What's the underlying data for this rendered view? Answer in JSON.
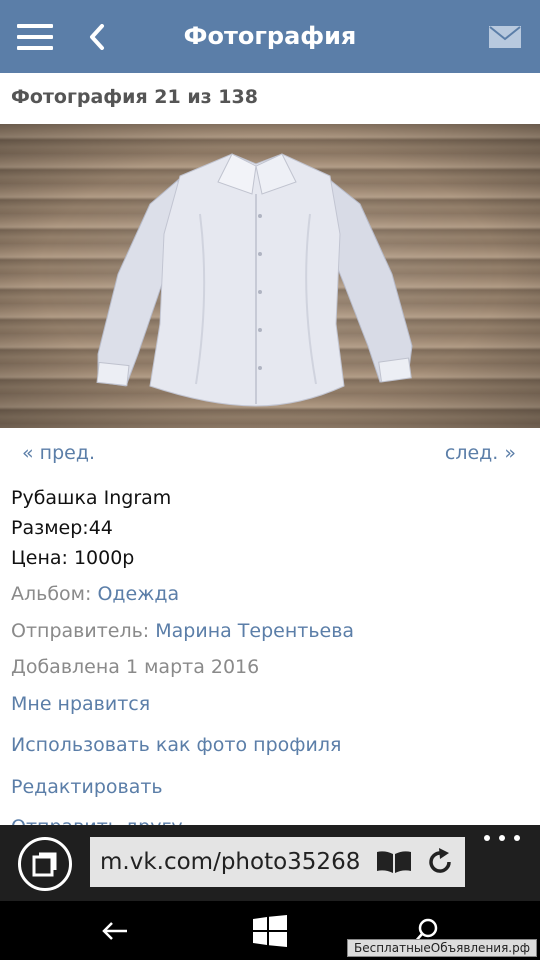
{
  "header": {
    "title": "Фотография",
    "menu_icon": "hamburger-menu-icon",
    "back_icon": "chevron-left-icon",
    "mail_icon": "envelope-icon",
    "background": "#5b7ea8"
  },
  "photo": {
    "counter": "Фотография 21 из 138",
    "prev_label": "« пред.",
    "next_label": "след. »"
  },
  "description": {
    "line1": "Рубашка Ingram",
    "line2": "Размер:44",
    "line3": "Цена: 1000р"
  },
  "meta": {
    "album_label": "Альбом: ",
    "album_name": "Одежда",
    "sender_label": "Отправитель: ",
    "sender_name": "Марина Терентьева",
    "added": "Добавлена 1 марта 2016"
  },
  "actions": {
    "like": "Мне нравится",
    "set_profile": "Использовать как фото профиля",
    "edit": "Редактировать",
    "send_friend": "Отправить другу"
  },
  "browser": {
    "url": "m.vk.com/photo35268",
    "tabs_icon": "tabs-icon",
    "reader_icon": "reading-view-icon",
    "refresh_icon": "refresh-icon",
    "more_icon": "more-dots-icon"
  },
  "system_nav": {
    "back_icon": "back-arrow-icon",
    "home_icon": "windows-logo-icon",
    "search_icon": "search-icon",
    "watermark": "БесплатныеОбъявления.рф"
  },
  "colors": {
    "link": "#5b7ea8",
    "meta_text": "#8a8a8a",
    "browser_bar": "#1f1f1f"
  }
}
